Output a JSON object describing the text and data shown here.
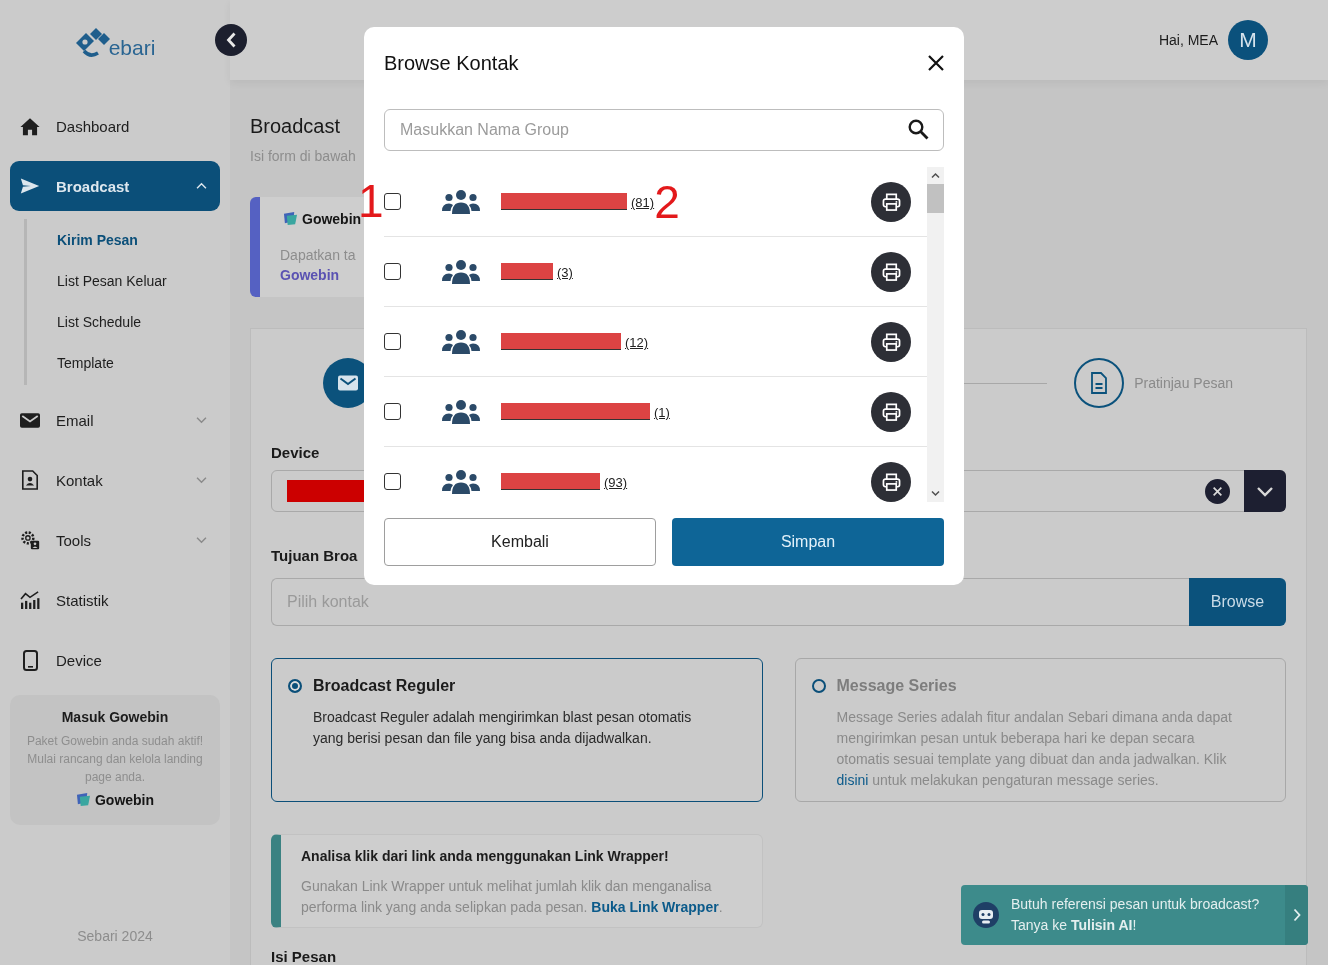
{
  "sidebar": {
    "logo": {
      "text": "ebari"
    },
    "items": [
      {
        "label": "Dashboard",
        "selected": false
      },
      {
        "label": "Broadcast",
        "selected": true,
        "expanded": true,
        "children": [
          {
            "label": "Kirim Pesan",
            "selected": true
          },
          {
            "label": "List Pesan Keluar",
            "selected": false
          },
          {
            "label": "List Schedule",
            "selected": false
          },
          {
            "label": "Template",
            "selected": false
          }
        ]
      },
      {
        "label": "Email",
        "selected": false,
        "expanded": false
      },
      {
        "label": "Kontak",
        "selected": false,
        "expanded": false
      },
      {
        "label": "Tools",
        "selected": false,
        "expanded": false
      },
      {
        "label": "Statistik",
        "selected": false
      },
      {
        "label": "Device",
        "selected": false
      }
    ],
    "promo": {
      "title": "Masuk Gowebin",
      "text": "Paket Gowebin anda sudah aktif! Mulai rancang dan kelola landing page anda.",
      "brand": "Gowebin"
    },
    "footer": "Sebari 2024"
  },
  "header": {
    "greeting": "Hai, MEA",
    "avatar": "M"
  },
  "page": {
    "title": "Broadcast",
    "subtitle": "Isi form di bawah",
    "gowebin_card": {
      "brand": "Gowebin",
      "text": "Dapatkan ta",
      "link": "Gowebin"
    },
    "stepper": {
      "steps": [
        {
          "selected": true
        },
        {
          "label": "Pratinjau Pesan",
          "selected": false
        }
      ]
    },
    "device": {
      "label": "Device",
      "redacted": true
    },
    "recipient": {
      "label": "Tujuan Broa",
      "placeholder": "Pilih kontak",
      "button": "Browse"
    },
    "options": [
      {
        "title": "Broadcast Reguler",
        "description": "Broadcast Reguler adalah mengirimkan blast pesan otomatis yang berisi pesan dan file yang bisa anda dijadwalkan.",
        "selected": true
      },
      {
        "title": "Message Series",
        "description": "Message Series adalah fitur andalan Sebari dimana anda dapat mengirimkan pesan untuk beberapa hari ke depan secara otomatis sesuai template yang dibuat dan anda jadwalkan. Klik",
        "link": "disini",
        "description_after": "untuk melakukan pengaturan message series.",
        "selected": false
      }
    ],
    "alert": {
      "title": "Analisa klik dari link anda menggunakan Link Wrapper!",
      "text": "Gunakan Link Wrapper untuk melihat jumlah klik dan menganalisa performa link yang anda selipkan pada pesan.",
      "link": "Buka Link Wrapper",
      "text_after": "."
    },
    "message_label": "Isi Pesan"
  },
  "chat_prompt": {
    "line1": "Butuh referensi pesan untuk broadcast?",
    "line2": "Tanya ke **Tulisin AI**!"
  },
  "modal": {
    "title": "Browse Kontak",
    "search": {
      "placeholder": "Masukkan Nama Group"
    },
    "rows": [
      {
        "checked": false,
        "redacted": true,
        "count": "(81)",
        "marker_before": "1",
        "marker_after": "2"
      },
      {
        "checked": false,
        "redacted": true,
        "count": "(3)"
      },
      {
        "checked": false,
        "redacted": true,
        "count": "(12)"
      },
      {
        "checked": false,
        "redacted": true,
        "count": "(1)"
      },
      {
        "checked": false,
        "redacted": true,
        "count": "(93)"
      }
    ],
    "buttons": [
      {
        "label": "Kembali",
        "kind": "secondary"
      },
      {
        "label": "Simpan",
        "kind": "primary"
      }
    ]
  }
}
